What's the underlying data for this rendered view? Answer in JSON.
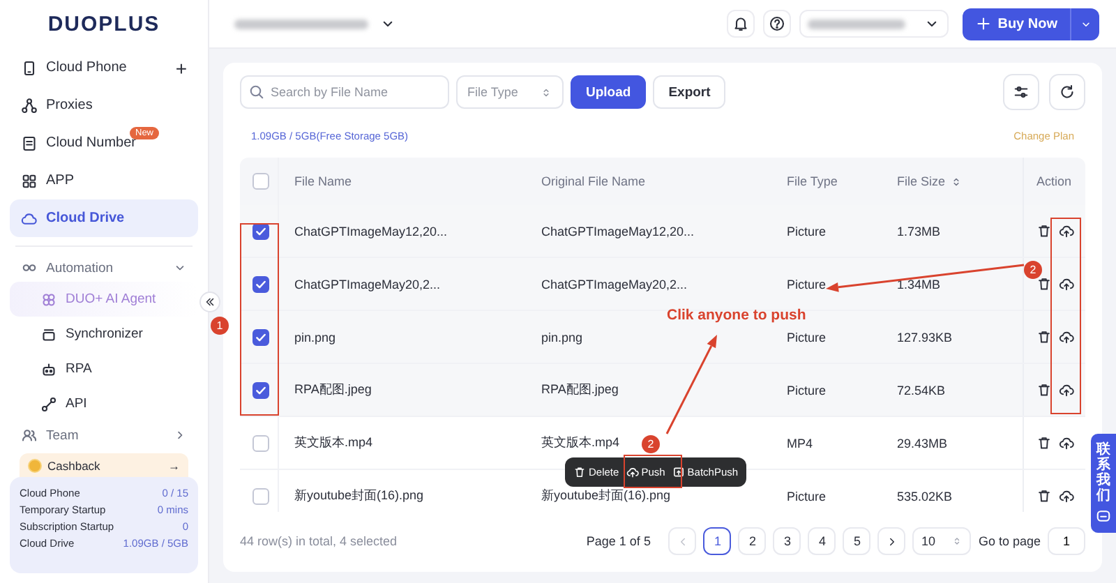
{
  "logo": "DUOPLUS",
  "sidebar": {
    "nav": [
      {
        "label": "Cloud Phone",
        "selected": false,
        "add": "+"
      },
      {
        "label": "Proxies",
        "selected": false
      },
      {
        "label": "Cloud Number",
        "selected": false,
        "badge": "New"
      },
      {
        "label": "APP",
        "selected": false
      },
      {
        "label": "Cloud Drive",
        "selected": true
      }
    ],
    "groups": [
      {
        "label": "Automation",
        "expanded": true,
        "children": [
          {
            "label": "DUO+ AI Agent",
            "kind": "featured"
          },
          {
            "label": "Synchronizer",
            "kind": "plain"
          },
          {
            "label": "RPA",
            "kind": "plain"
          },
          {
            "label": "API",
            "kind": "plain"
          }
        ]
      },
      {
        "label": "Team",
        "expanded": false
      }
    ],
    "cashback": {
      "label": "Cashback",
      "arrow": "→"
    },
    "usage": [
      {
        "label": "Cloud Phone",
        "value": "0 / 15"
      },
      {
        "label": "Temporary Startup",
        "value": "0 mins"
      },
      {
        "label": "Subscription Startup",
        "value": "0"
      },
      {
        "label": "Cloud Drive",
        "value": "1.09GB / 5GB"
      }
    ]
  },
  "header": {
    "buy_button": "Buy Now"
  },
  "toolbar": {
    "search": {
      "placeholder": "Search by File Name"
    },
    "file_type": {
      "placeholder": "File Type"
    },
    "buttons": [
      {
        "label": "Upload",
        "kind": "primary"
      },
      {
        "label": "Export",
        "kind": "default"
      }
    ]
  },
  "storage": {
    "text": "1.09GB / 5GB(Free Storage 5GB)",
    "link": "Change Plan"
  },
  "table": {
    "all_checked": false,
    "columns": [
      {
        "label": "File Name",
        "sortable": false
      },
      {
        "label": "Original File Name",
        "sortable": false
      },
      {
        "label": "File Type",
        "sortable": false
      },
      {
        "label": "File Size",
        "sortable": true
      },
      {
        "label": "Action",
        "sortable": false
      }
    ],
    "rows": [
      {
        "checked": true,
        "file_name": "ChatGPTImageMay12,20...",
        "original_name": "ChatGPTImageMay12,20...",
        "type": "Picture",
        "size": "1.73MB"
      },
      {
        "checked": true,
        "file_name": "ChatGPTImageMay20,2...",
        "original_name": "ChatGPTImageMay20,2...",
        "type": "Picture",
        "size": "1.34MB"
      },
      {
        "checked": true,
        "file_name": "pin.png",
        "original_name": "pin.png",
        "type": "Picture",
        "size": "127.93KB"
      },
      {
        "checked": true,
        "file_name": "RPA配图.jpeg",
        "original_name": "RPA配图.jpeg",
        "type": "Picture",
        "size": "72.54KB"
      },
      {
        "checked": false,
        "file_name": "英文版本.mp4",
        "original_name": "英文版本.mp4",
        "type": "MP4",
        "size": "29.43MB"
      },
      {
        "checked": false,
        "file_name": "新youtube封面(16).png",
        "original_name": "新youtube封面(16).png",
        "type": "Picture",
        "size": "535.02KB"
      }
    ]
  },
  "bulk_actions": [
    {
      "label": "Delete",
      "kind": "delete"
    },
    {
      "label": "Push",
      "kind": "push"
    },
    {
      "label": "BatchPush",
      "kind": "batch"
    }
  ],
  "pagination": {
    "summary": "44 row(s) in total, 4 selected",
    "page_info": "Page 1 of 5",
    "pages": [
      {
        "label": "1",
        "selected": true
      },
      {
        "label": "2",
        "selected": false
      },
      {
        "label": "3",
        "selected": false
      },
      {
        "label": "4",
        "selected": false
      },
      {
        "label": "5",
        "selected": false
      }
    ],
    "page_size": "10",
    "goto_label": "Go to page",
    "goto_value": "1"
  },
  "annotations": {
    "note": "Clik anyone to push",
    "badges": [
      "1",
      "2",
      "2"
    ]
  },
  "contact_tab": "联系我们"
}
